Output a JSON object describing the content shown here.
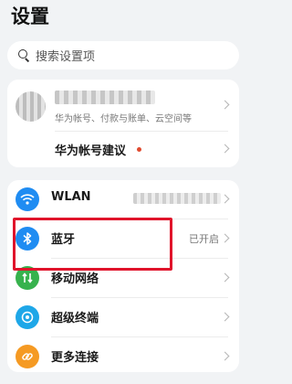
{
  "page": {
    "title": "设置"
  },
  "search": {
    "placeholder": "搜索设置项"
  },
  "account": {
    "subtitle": "华为帐号、付款与账单、云空间等",
    "suggestion_label": "华为帐号建议"
  },
  "settings": [
    {
      "id": "wlan",
      "label": "WLAN",
      "icon": "wifi-icon",
      "color": "#1f8cf2"
    },
    {
      "id": "bluetooth",
      "label": "蓝牙",
      "value": "已开启",
      "icon": "bluetooth-icon",
      "color": "#1f8cf2"
    },
    {
      "id": "mobile",
      "label": "移动网络",
      "icon": "mobile-network-icon",
      "color": "#37b24d"
    },
    {
      "id": "super",
      "label": "超级终端",
      "icon": "super-device-icon",
      "color": "#1ea7e8"
    },
    {
      "id": "more",
      "label": "更多连接",
      "icon": "link-icon",
      "color": "#f59a23"
    }
  ],
  "colors": {
    "accent": "#1f8cf2",
    "highlight": "#e0142b",
    "background": "#f1f3f5"
  }
}
